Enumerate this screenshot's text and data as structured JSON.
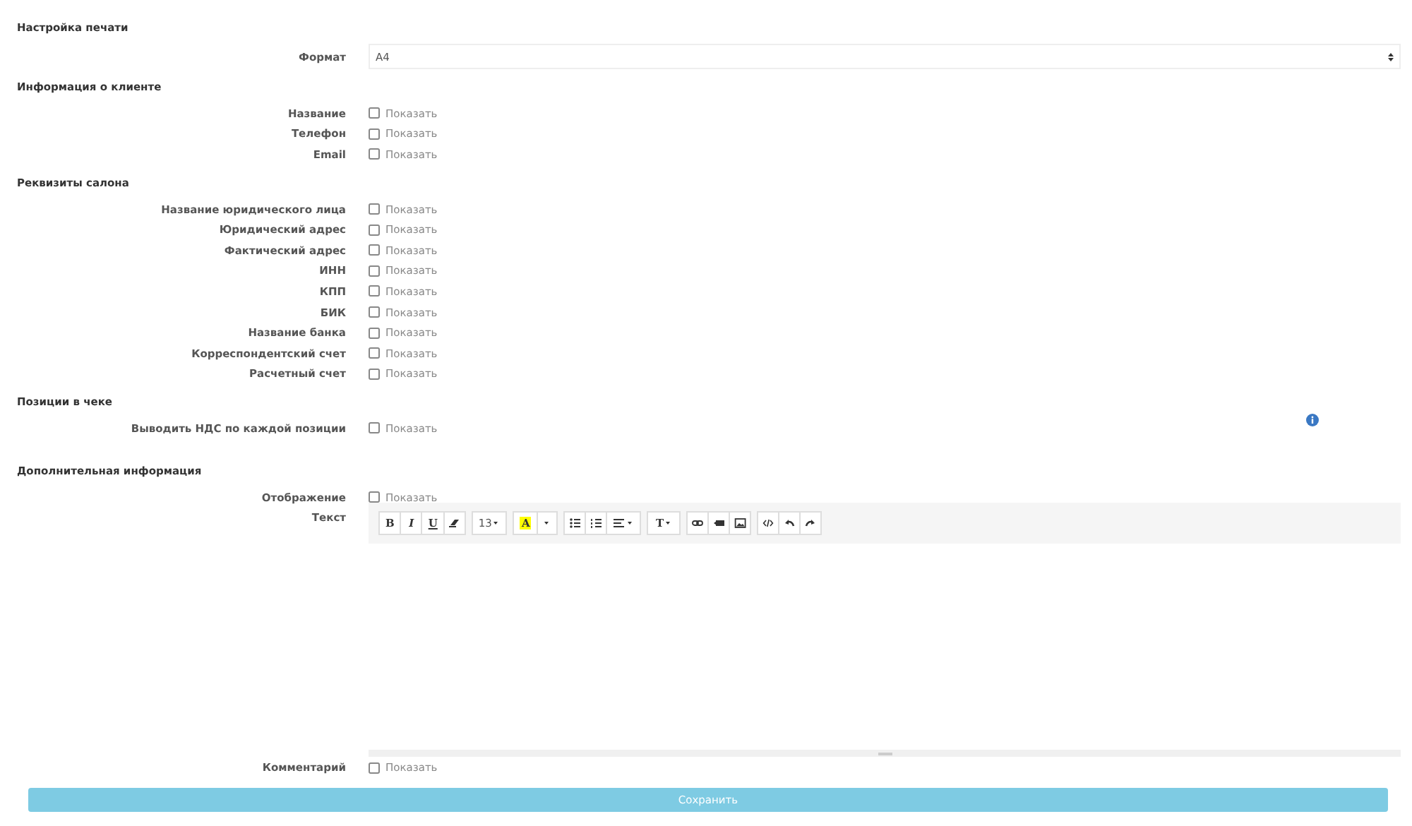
{
  "sections": [
    {
      "title": "Настройка печати",
      "rows": [
        {
          "kind": "select",
          "label": "Формат",
          "value": "A4"
        }
      ]
    },
    {
      "title": "Информация о клиенте",
      "rows": [
        {
          "kind": "checkbox",
          "label": "Название",
          "option": "Показать",
          "checked": false
        },
        {
          "kind": "checkbox",
          "label": "Телефон",
          "option": "Показать",
          "checked": false
        },
        {
          "kind": "checkbox",
          "label": "Email",
          "option": "Показать",
          "checked": false
        }
      ]
    },
    {
      "title": "Реквизиты салона",
      "rows": [
        {
          "kind": "checkbox",
          "label": "Название юридического лица",
          "option": "Показать",
          "checked": false
        },
        {
          "kind": "checkbox",
          "label": "Юридический адрес",
          "option": "Показать",
          "checked": false
        },
        {
          "kind": "checkbox",
          "label": "Фактический адрес",
          "option": "Показать",
          "checked": false
        },
        {
          "kind": "checkbox",
          "label": "ИНН",
          "option": "Показать",
          "checked": false
        },
        {
          "kind": "checkbox",
          "label": "КПП",
          "option": "Показать",
          "checked": false
        },
        {
          "kind": "checkbox",
          "label": "БИК",
          "option": "Показать",
          "checked": false
        },
        {
          "kind": "checkbox",
          "label": "Название банка",
          "option": "Показать",
          "checked": false
        },
        {
          "kind": "checkbox",
          "label": "Корреспондентский счет",
          "option": "Показать",
          "checked": false
        },
        {
          "kind": "checkbox",
          "label": "Расчетный счет",
          "option": "Показать",
          "checked": false
        }
      ]
    },
    {
      "title": "Позиции в чеке",
      "rows": [
        {
          "kind": "checkbox-info",
          "label": "Выводить НДС по каждой позиции",
          "option": "Показать",
          "checked": false
        }
      ]
    },
    {
      "title": "Дополнительная информация",
      "rows": [
        {
          "kind": "checkbox",
          "label": "Отображение",
          "option": "Показать",
          "checked": false
        },
        {
          "kind": "editor",
          "label": "Текст",
          "toolbar": [
            [
              {
                "kind": "text",
                "label": "B"
              },
              {
                "kind": "text",
                "label": "I"
              },
              {
                "kind": "text",
                "label": "U"
              },
              {
                "kind": "icon"
              }
            ],
            [
              {
                "kind": "text-dropdown",
                "label": "13"
              }
            ],
            [
              {
                "kind": "text",
                "label": "A"
              },
              {
                "kind": "icon"
              }
            ],
            [
              {
                "kind": "icon"
              },
              {
                "kind": "icon"
              },
              {
                "kind": "icon-dropdown"
              }
            ],
            [
              {
                "kind": "text-dropdown",
                "label": "T"
              }
            ],
            [
              {
                "kind": "icon"
              },
              {
                "kind": "icon"
              },
              {
                "kind": "icon"
              }
            ],
            [
              {
                "kind": "icon"
              },
              {
                "kind": "icon"
              },
              {
                "kind": "icon"
              }
            ]
          ]
        },
        {
          "kind": "checkbox",
          "label": "Комментарий",
          "option": "Показать",
          "checked": false
        }
      ]
    }
  ],
  "save_button": "Сохранить"
}
